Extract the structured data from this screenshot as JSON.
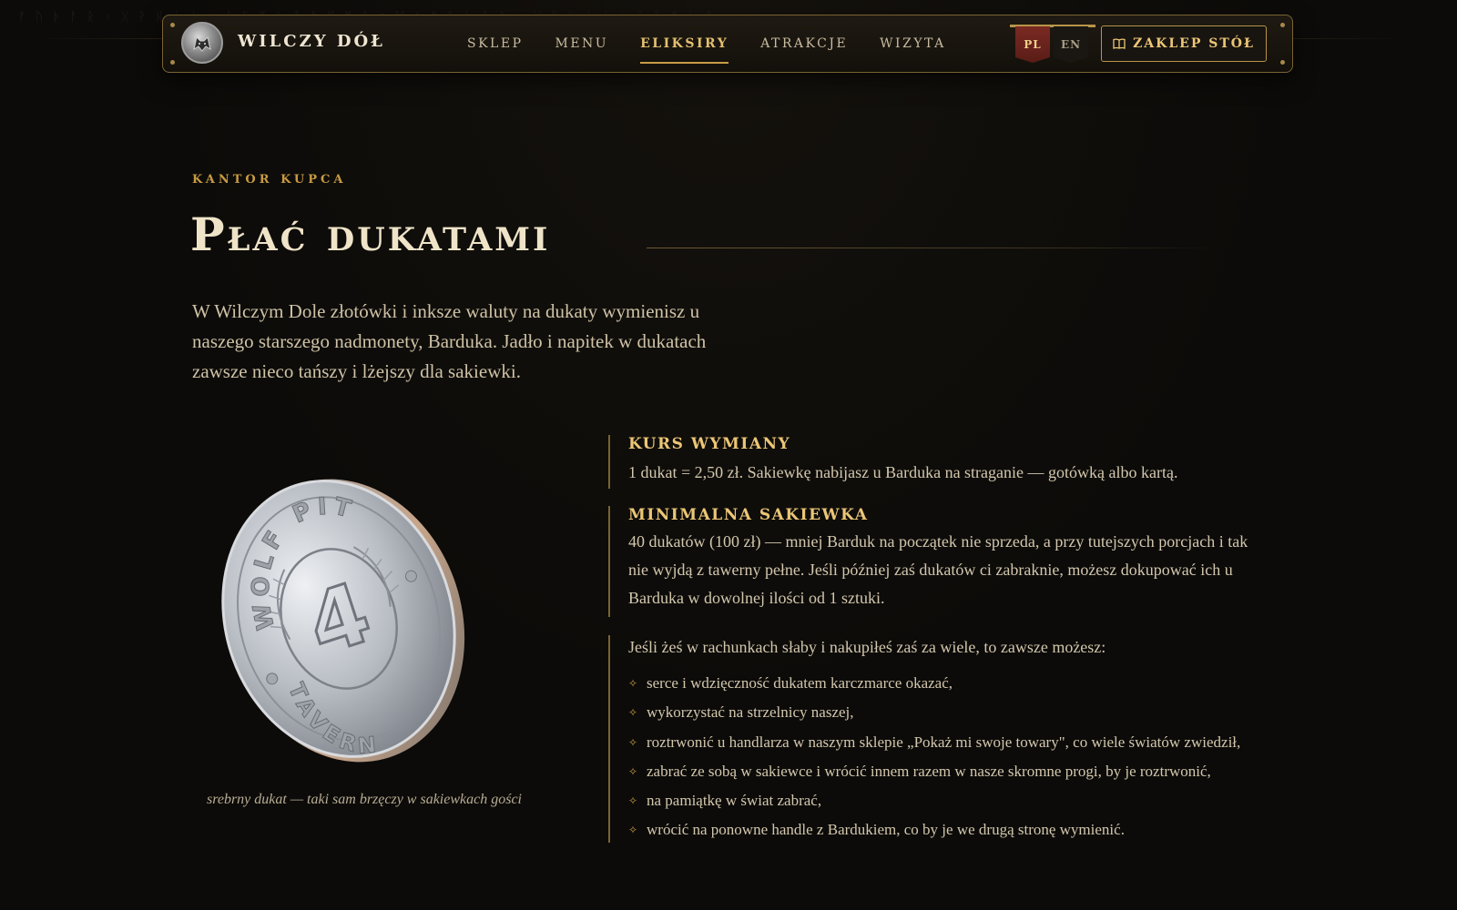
{
  "runes": "ᚠ ᚢ ᚦ ᚨ ᚱ ᚲ ᚷ ᚹ ᚺ ᚾ ᛁ ᛃ ᛇ ᛈ ᛉ ᛊ ᛏ ᛒ ᛖ ᛗ ᛚ ᛜ ᛞ ᛟ ᚠ ᚢ ᚦ ᚨ ᚱ ᚲ ᚷ ᚹ ᚺ ᚾ ᛁ ᛃ ᛇ ᛈ ᛉ ᛊ ᛏ",
  "header": {
    "brand": "WILCZY DÓŁ",
    "nav": [
      {
        "label": "SKLEP"
      },
      {
        "label": "MENU"
      },
      {
        "label": "ELIKSIRY"
      },
      {
        "label": "ATRAKCJE"
      },
      {
        "label": "WIZYTA"
      }
    ],
    "active_nav": "ELIKSIRY",
    "languages": [
      "PL",
      "EN"
    ],
    "active_language": "PL",
    "cta_label": "ZAKLEP STÓŁ",
    "cta_icon": "book-icon"
  },
  "hero": {
    "eyebrow": "KANTOR KUPCA",
    "title": "Płać dukatami",
    "intro": "W Wilczym Dole złotówki i inksze waluty na dukaty wymienisz u naszego starszego nadmonety, Barduka. Jadło i napitek w dukatach zawsze nieco tańszy i lżejszy dla sakiewki."
  },
  "coin": {
    "top_text": "WOLF PIT",
    "bottom_text": "TAVERN",
    "center_mark": "4",
    "caption": "srebrny dukat — taki sam brzęczy w sakiewkach gości"
  },
  "exchange": {
    "title": "KURS WYMIANY",
    "text": "1 dukat = 2,50 zł. Sakiewkę nabijasz u Barduka na straganie — gotówką albo kartą."
  },
  "minimum": {
    "title": "MINIMALNA SAKIEWKA",
    "text": "40 dukatów (100 zł) — mniej Barduk na początek nie sprzeda, a przy tutejszych porcjach i tak nie wyjdą z tawerny pełne. Jeśli później zaś dukatów ci zabraknie, możesz dokupować ich u Barduka w dowolnej ilości od 1 sztuki."
  },
  "leftover": {
    "intro": "Jeśli żeś w rachunkach słaby i nakupiłeś zaś za wiele, to zawsze możesz:",
    "items": [
      "serce i wdzięczność dukatem karczmarce okazać,",
      "wykorzystać na strzelnicy naszej,",
      "roztrwonić u handlarza w naszym sklepie „Pokaż mi swoje towary\", co wiele światów zwiedził,",
      "zabrać ze sobą w sakiewce i wrócić innem razem w nasze skromne progi, by je roztrwonić,",
      "na pamiątkę w świat zabrać,",
      "wrócić na ponowne handle z Bardukiem, co by je we drugą stronę wymienić."
    ],
    "bullet_icon": "diamond-bullet-icon"
  },
  "colors": {
    "background": "#0c0b09",
    "gold_accent": "#c89a42",
    "title_cream": "#efe4c8",
    "active_lang_red": "#7a2a22"
  }
}
